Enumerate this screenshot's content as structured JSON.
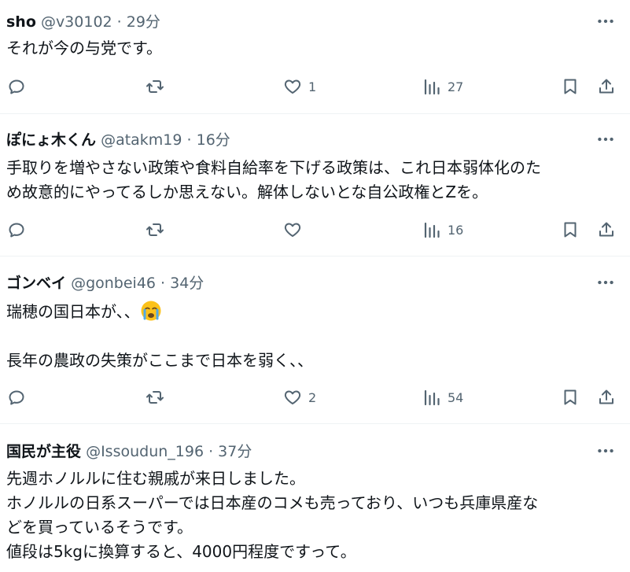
{
  "tweets": [
    {
      "name": "sho",
      "handle": "@v30102",
      "time": "29分",
      "lines": [
        "それが今の与党です。"
      ],
      "replies": "",
      "retweets": "",
      "likes": "1",
      "views": "27"
    },
    {
      "name": "ぽにょ木くん",
      "handle": "@atakm19",
      "time": "16分",
      "lines": [
        "手取りを増やさない政策や食料自給率を下げる政策は、これ日本弱体化のた",
        "め故意的にやってるしか思えない。解体しないとな自公政権とZを。"
      ],
      "replies": "",
      "retweets": "",
      "likes": "",
      "views": "16"
    },
    {
      "name": "ゴンベイ",
      "handle": "@gonbei46",
      "time": "34分",
      "lines": [
        "瑞穂の国日本が、、",
        "",
        "長年の農政の失策がここまで日本を弱く、、"
      ],
      "replies": "",
      "retweets": "",
      "likes": "2",
      "views": "54"
    },
    {
      "name": "国民が主役",
      "handle": "@Issoudun_196",
      "time": "37分",
      "lines": [
        "先週ホノルルに住む親戚が来日しました。",
        "ホノルルの日系スーパーでは日本産のコメも売っており、いつも兵庫県産な",
        "どを買っているそうです。",
        "値段は5kgに換算すると、4000円程度ですって。"
      ]
    }
  ],
  "sep": " · ",
  "icons": [
    "more-icon",
    "reply-icon",
    "retweet-icon",
    "like-icon",
    "views-icon",
    "bookmark-icon",
    "share-icon",
    "crying-face-emoji"
  ],
  "colors": {
    "text": "#0f1419",
    "secondary": "#536471",
    "divider": "#eff3f4",
    "emoji": "#fcc21b"
  }
}
